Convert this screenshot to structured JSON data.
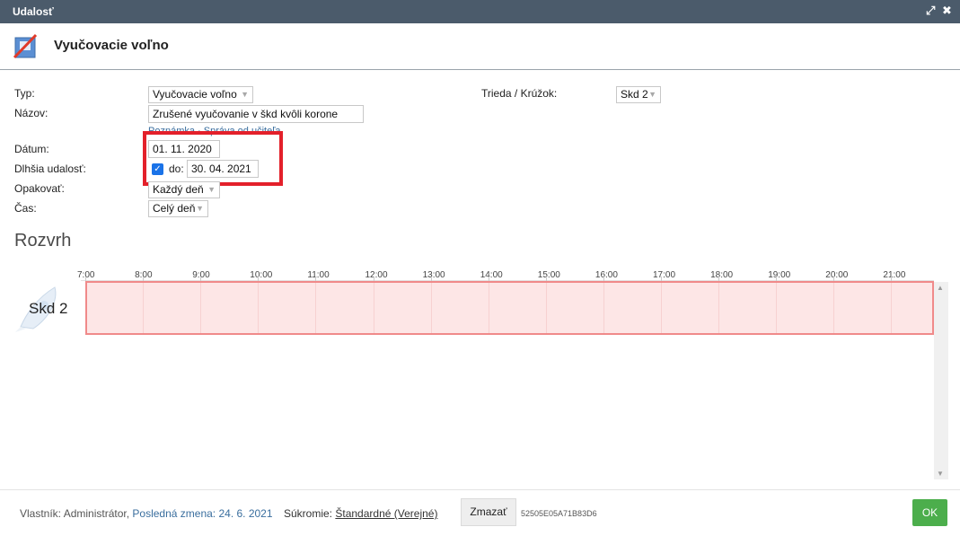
{
  "window": {
    "title": "Udalosť"
  },
  "header": {
    "title": "Vyučovacie voľno"
  },
  "form": {
    "typ_label": "Typ:",
    "typ_value": "Vyučovacie voľno",
    "trieda_label": "Trieda / Krúžok:",
    "trieda_value": "Skd 2",
    "nazov_label": "Názov:",
    "nazov_value": "Zrušené vyučovanie v škd kvôli korone",
    "links": {
      "poznamka": "Poznámka",
      "sep": " · ",
      "sprava": "Správa od učiteľa"
    },
    "datum_label": "Dátum:",
    "datum_value": "01. 11. 2020",
    "dlhsia_label": "Dlhšia udalosť:",
    "do_label": "do:",
    "do_value": "30. 04. 2021",
    "opakovat_label": "Opakovať:",
    "opakovat_value": "Každý deň",
    "cas_label": "Čas:",
    "cas_value": "Celý deň"
  },
  "schedule": {
    "title": "Rozvrh",
    "hours": [
      "7:00",
      "8:00",
      "9:00",
      "10:00",
      "11:00",
      "12:00",
      "13:00",
      "14:00",
      "15:00",
      "16:00",
      "17:00",
      "18:00",
      "19:00",
      "20:00",
      "21:00"
    ],
    "row_label": "Skd 2"
  },
  "footer": {
    "owner_label": "Vlastník: Administrátor,",
    "last_change_label": "Posledná zmena: 24. 6. 2021",
    "privacy_label": "Súkromie:",
    "privacy_value": "Štandardné (Verejné)",
    "delete_label": "Zmazať",
    "code": "52505E05A71B83D6",
    "ok_label": "OK"
  },
  "colors": {
    "titlebar": "#4b5b6b",
    "highlight": "#e3202a",
    "event": "#fde6e6",
    "ok": "#4cae4c",
    "link": "#3a6e9e"
  }
}
